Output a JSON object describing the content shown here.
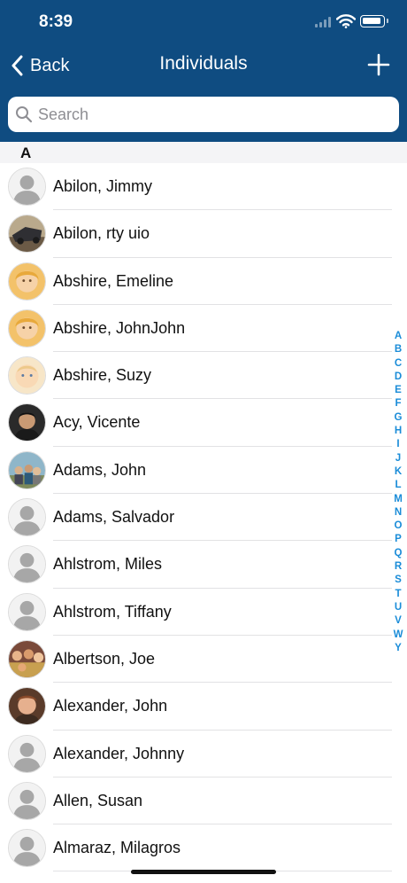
{
  "status_bar": {
    "time": "8:39"
  },
  "nav": {
    "back_label": "Back",
    "title": "Individuals",
    "add_icon": "plus-icon"
  },
  "search": {
    "placeholder": "Search",
    "value": ""
  },
  "section": {
    "letter": "A"
  },
  "contacts": [
    {
      "name": "Abilon, Jimmy",
      "photo": "placeholder"
    },
    {
      "name": "Abilon, rty uio",
      "photo": "photo-car"
    },
    {
      "name": "Abshire, Emeline",
      "photo": "photo-blonde"
    },
    {
      "name": "Abshire, JohnJohn",
      "photo": "photo-blonde"
    },
    {
      "name": "Abshire, Suzy",
      "photo": "photo-baby"
    },
    {
      "name": "Acy, Vicente",
      "photo": "photo-man-dark"
    },
    {
      "name": "Adams, John",
      "photo": "photo-group"
    },
    {
      "name": "Adams, Salvador",
      "photo": "placeholder"
    },
    {
      "name": "Ahlstrom, Miles",
      "photo": "placeholder"
    },
    {
      "name": "Ahlstrom, Tiffany",
      "photo": "placeholder"
    },
    {
      "name": "Albertson, Joe",
      "photo": "photo-crowd"
    },
    {
      "name": "Alexander, John",
      "photo": "photo-man-red"
    },
    {
      "name": "Alexander, Johnny",
      "photo": "placeholder"
    },
    {
      "name": "Allen, Susan",
      "photo": "placeholder"
    },
    {
      "name": "Almaraz, Milagros",
      "photo": "placeholder"
    }
  ],
  "index_letters": [
    "A",
    "B",
    "C",
    "D",
    "E",
    "F",
    "G",
    "H",
    "I",
    "J",
    "K",
    "L",
    "M",
    "N",
    "O",
    "P",
    "Q",
    "R",
    "S",
    "T",
    "U",
    "V",
    "W",
    "Y"
  ],
  "colors": {
    "nav_bg": "#0f4c81",
    "index_accent": "#1a8cd8"
  }
}
